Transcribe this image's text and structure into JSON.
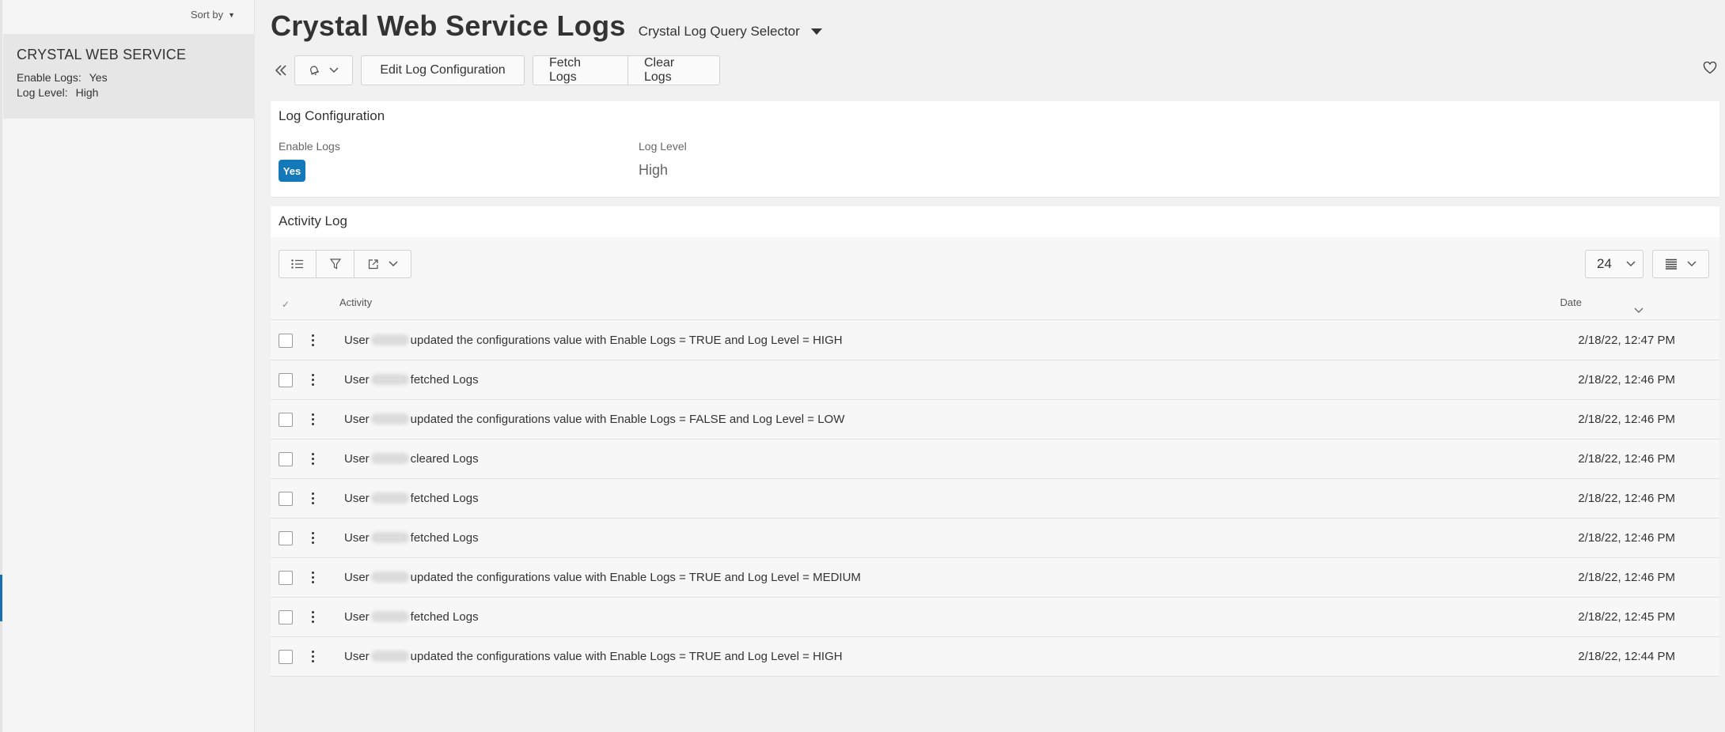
{
  "navigator": {
    "sort_label": "Sort by",
    "item": {
      "title": "CRYSTAL WEB SERVICE",
      "enable_logs_label": "Enable Logs:",
      "enable_logs_value": "Yes",
      "log_level_label": "Log Level:",
      "log_level_value": "High"
    }
  },
  "header": {
    "title": "Crystal Web Service Logs",
    "query_selector": "Crystal Log Query Selector"
  },
  "toolbar": {
    "edit_label": "Edit Log Configuration",
    "fetch_label": "Fetch Logs",
    "clear_label": "Clear Logs"
  },
  "log_configuration": {
    "title": "Log Configuration",
    "enable_logs_label": "Enable Logs",
    "enable_logs_value": "Yes",
    "log_level_label": "Log Level",
    "log_level_value": "High"
  },
  "activity_log": {
    "title": "Activity Log",
    "page_size": "24",
    "columns": {
      "activity": "Activity",
      "date": "Date"
    },
    "rows": [
      {
        "prefix": "User",
        "text": "updated the configurations value with Enable Logs = TRUE and Log Level = HIGH",
        "date": "2/18/22, 12:47 PM"
      },
      {
        "prefix": "User",
        "text": "fetched Logs",
        "date": "2/18/22, 12:46 PM"
      },
      {
        "prefix": "User",
        "text": "updated the configurations value with Enable Logs = FALSE and Log Level = LOW",
        "date": "2/18/22, 12:46 PM"
      },
      {
        "prefix": "User",
        "text": "cleared Logs",
        "date": "2/18/22, 12:46 PM"
      },
      {
        "prefix": "User",
        "text": "fetched Logs",
        "date": "2/18/22, 12:46 PM"
      },
      {
        "prefix": "User",
        "text": "fetched Logs",
        "date": "2/18/22, 12:46 PM"
      },
      {
        "prefix": "User",
        "text": "updated the configurations value with Enable Logs = TRUE and Log Level = MEDIUM",
        "date": "2/18/22, 12:46 PM"
      },
      {
        "prefix": "User",
        "text": "fetched Logs",
        "date": "2/18/22, 12:45 PM"
      },
      {
        "prefix": "User",
        "text": "updated the configurations value with Enable Logs = TRUE and Log Level = HIGH",
        "date": "2/18/22, 12:44 PM"
      }
    ]
  },
  "icons": {
    "collapse": "double-chevron-left-icon",
    "notifications": "bell-icon",
    "favorite": "heart-icon",
    "list_view": "bulleted-list-icon",
    "filter": "filter-icon",
    "export": "export-icon",
    "table_view": "table-rows-icon"
  },
  "colors": {
    "accent": "#1479b8",
    "nav_accent": "#1a6fb0"
  }
}
